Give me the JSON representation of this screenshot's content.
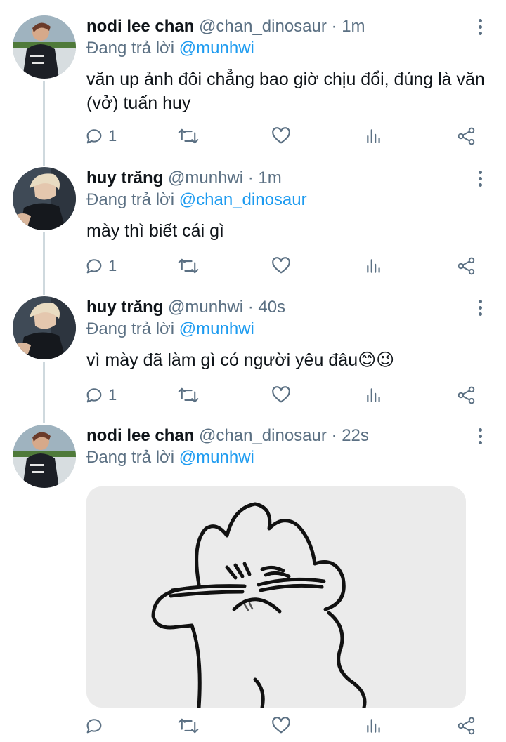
{
  "tweets": [
    {
      "name": "nodi lee chan",
      "handle": "@chan_dinosaur",
      "time": "1m",
      "reply_prefix": "Đang trả lời ",
      "reply_to": "@munhwi",
      "text": "văn up ảnh đôi chẳng bao giờ chịu đổi, đúng là văn (vở) tuấn huy",
      "reply_count": "1",
      "avatar": "avatar-nodi"
    },
    {
      "name": "huy trăng",
      "handle": "@munhwi",
      "time": "1m",
      "reply_prefix": "Đang trả lời ",
      "reply_to": "@chan_dinosaur",
      "text": "mày thì biết cái gì",
      "reply_count": "1",
      "avatar": "avatar-huy"
    },
    {
      "name": "huy trăng",
      "handle": "@munhwi",
      "time": "40s",
      "reply_prefix": "Đang trả lời ",
      "reply_to": "@munhwi",
      "text": "vì mày đã làm gì có người yêu đâu😊😉",
      "reply_count": "1",
      "avatar": "avatar-huy"
    },
    {
      "name": "nodi lee chan",
      "handle": "@chan_dinosaur",
      "time": "22s",
      "reply_prefix": "Đang trả lời ",
      "reply_to": "@munhwi",
      "text": "",
      "reply_count": "",
      "avatar": "avatar-nodi",
      "media": "grumpy-cartoon-sticker"
    }
  ],
  "separator": " · ",
  "icons": [
    "reply-icon",
    "retweet-icon",
    "like-icon",
    "analytics-icon",
    "share-icon",
    "more-options-icon"
  ],
  "colors": {
    "name": "#0f1419",
    "meta": "#5b7083",
    "mention": "#1d9bf0",
    "thread_line": "#cfd9de"
  }
}
